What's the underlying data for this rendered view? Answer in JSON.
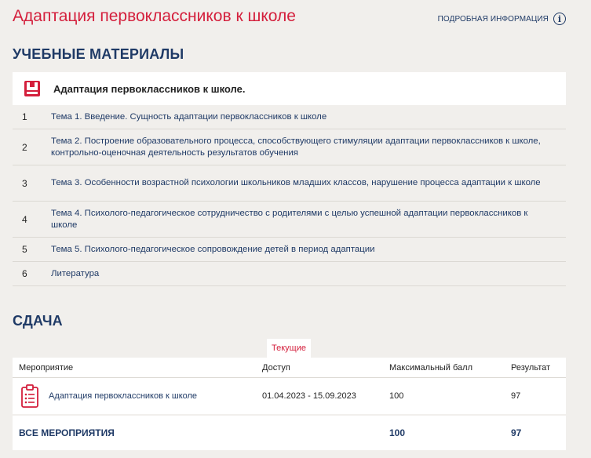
{
  "header": {
    "title": "Адаптация первоклассников к школе",
    "more_info_label": "ПОДРОБНАЯ ИНФОРМАЦИЯ",
    "info_glyph": "i"
  },
  "materials": {
    "heading": "УЧЕБНЫЕ МАТЕРИАЛЫ",
    "course_title": "Адаптация первоклассников к школе.",
    "topics": [
      {
        "num": "1",
        "text": "Тема 1. Введение. Сущность адаптации первоклассников к школе"
      },
      {
        "num": "2",
        "text": "Тема 2. Построение образовательного процесса, способствующего стимуляции адаптации первоклассников к школе, контрольно-оценочная деятельность результатов обучения"
      },
      {
        "num": "3",
        "text": "Тема 3. Особенности возрастной психологии школьников младших классов, нарушение процесса адаптации к школе"
      },
      {
        "num": "4",
        "text": "Тема 4. Психолого-педагогическое сотрудничество с родителями с целью успешной адаптации первоклассников к школе"
      },
      {
        "num": "5",
        "text": "Тема 5. Психолого-педагогическое сопровождение детей в период адаптации"
      },
      {
        "num": "6",
        "text": "Литература"
      }
    ]
  },
  "exam": {
    "heading": "СДАЧА",
    "tab_current": "Текущие",
    "columns": {
      "event": "Мероприятие",
      "access": "Доступ",
      "max_score": "Максимальный балл",
      "result": "Результат"
    },
    "rows": [
      {
        "name": "Адаптация первоклассников к школе",
        "access": "01.04.2023 - 15.09.2023",
        "max_score": "100",
        "result": "97"
      }
    ],
    "total": {
      "label": "ВСЕ МЕРОПРИЯТИЯ",
      "max_score": "100",
      "result": "97"
    }
  },
  "colors": {
    "accent_red": "#d41f3c",
    "navy": "#1f3a66",
    "background": "#f1efec"
  },
  "icons": {
    "course": "book-icon",
    "event": "clipboard-list-icon",
    "info": "info-circle-icon"
  }
}
